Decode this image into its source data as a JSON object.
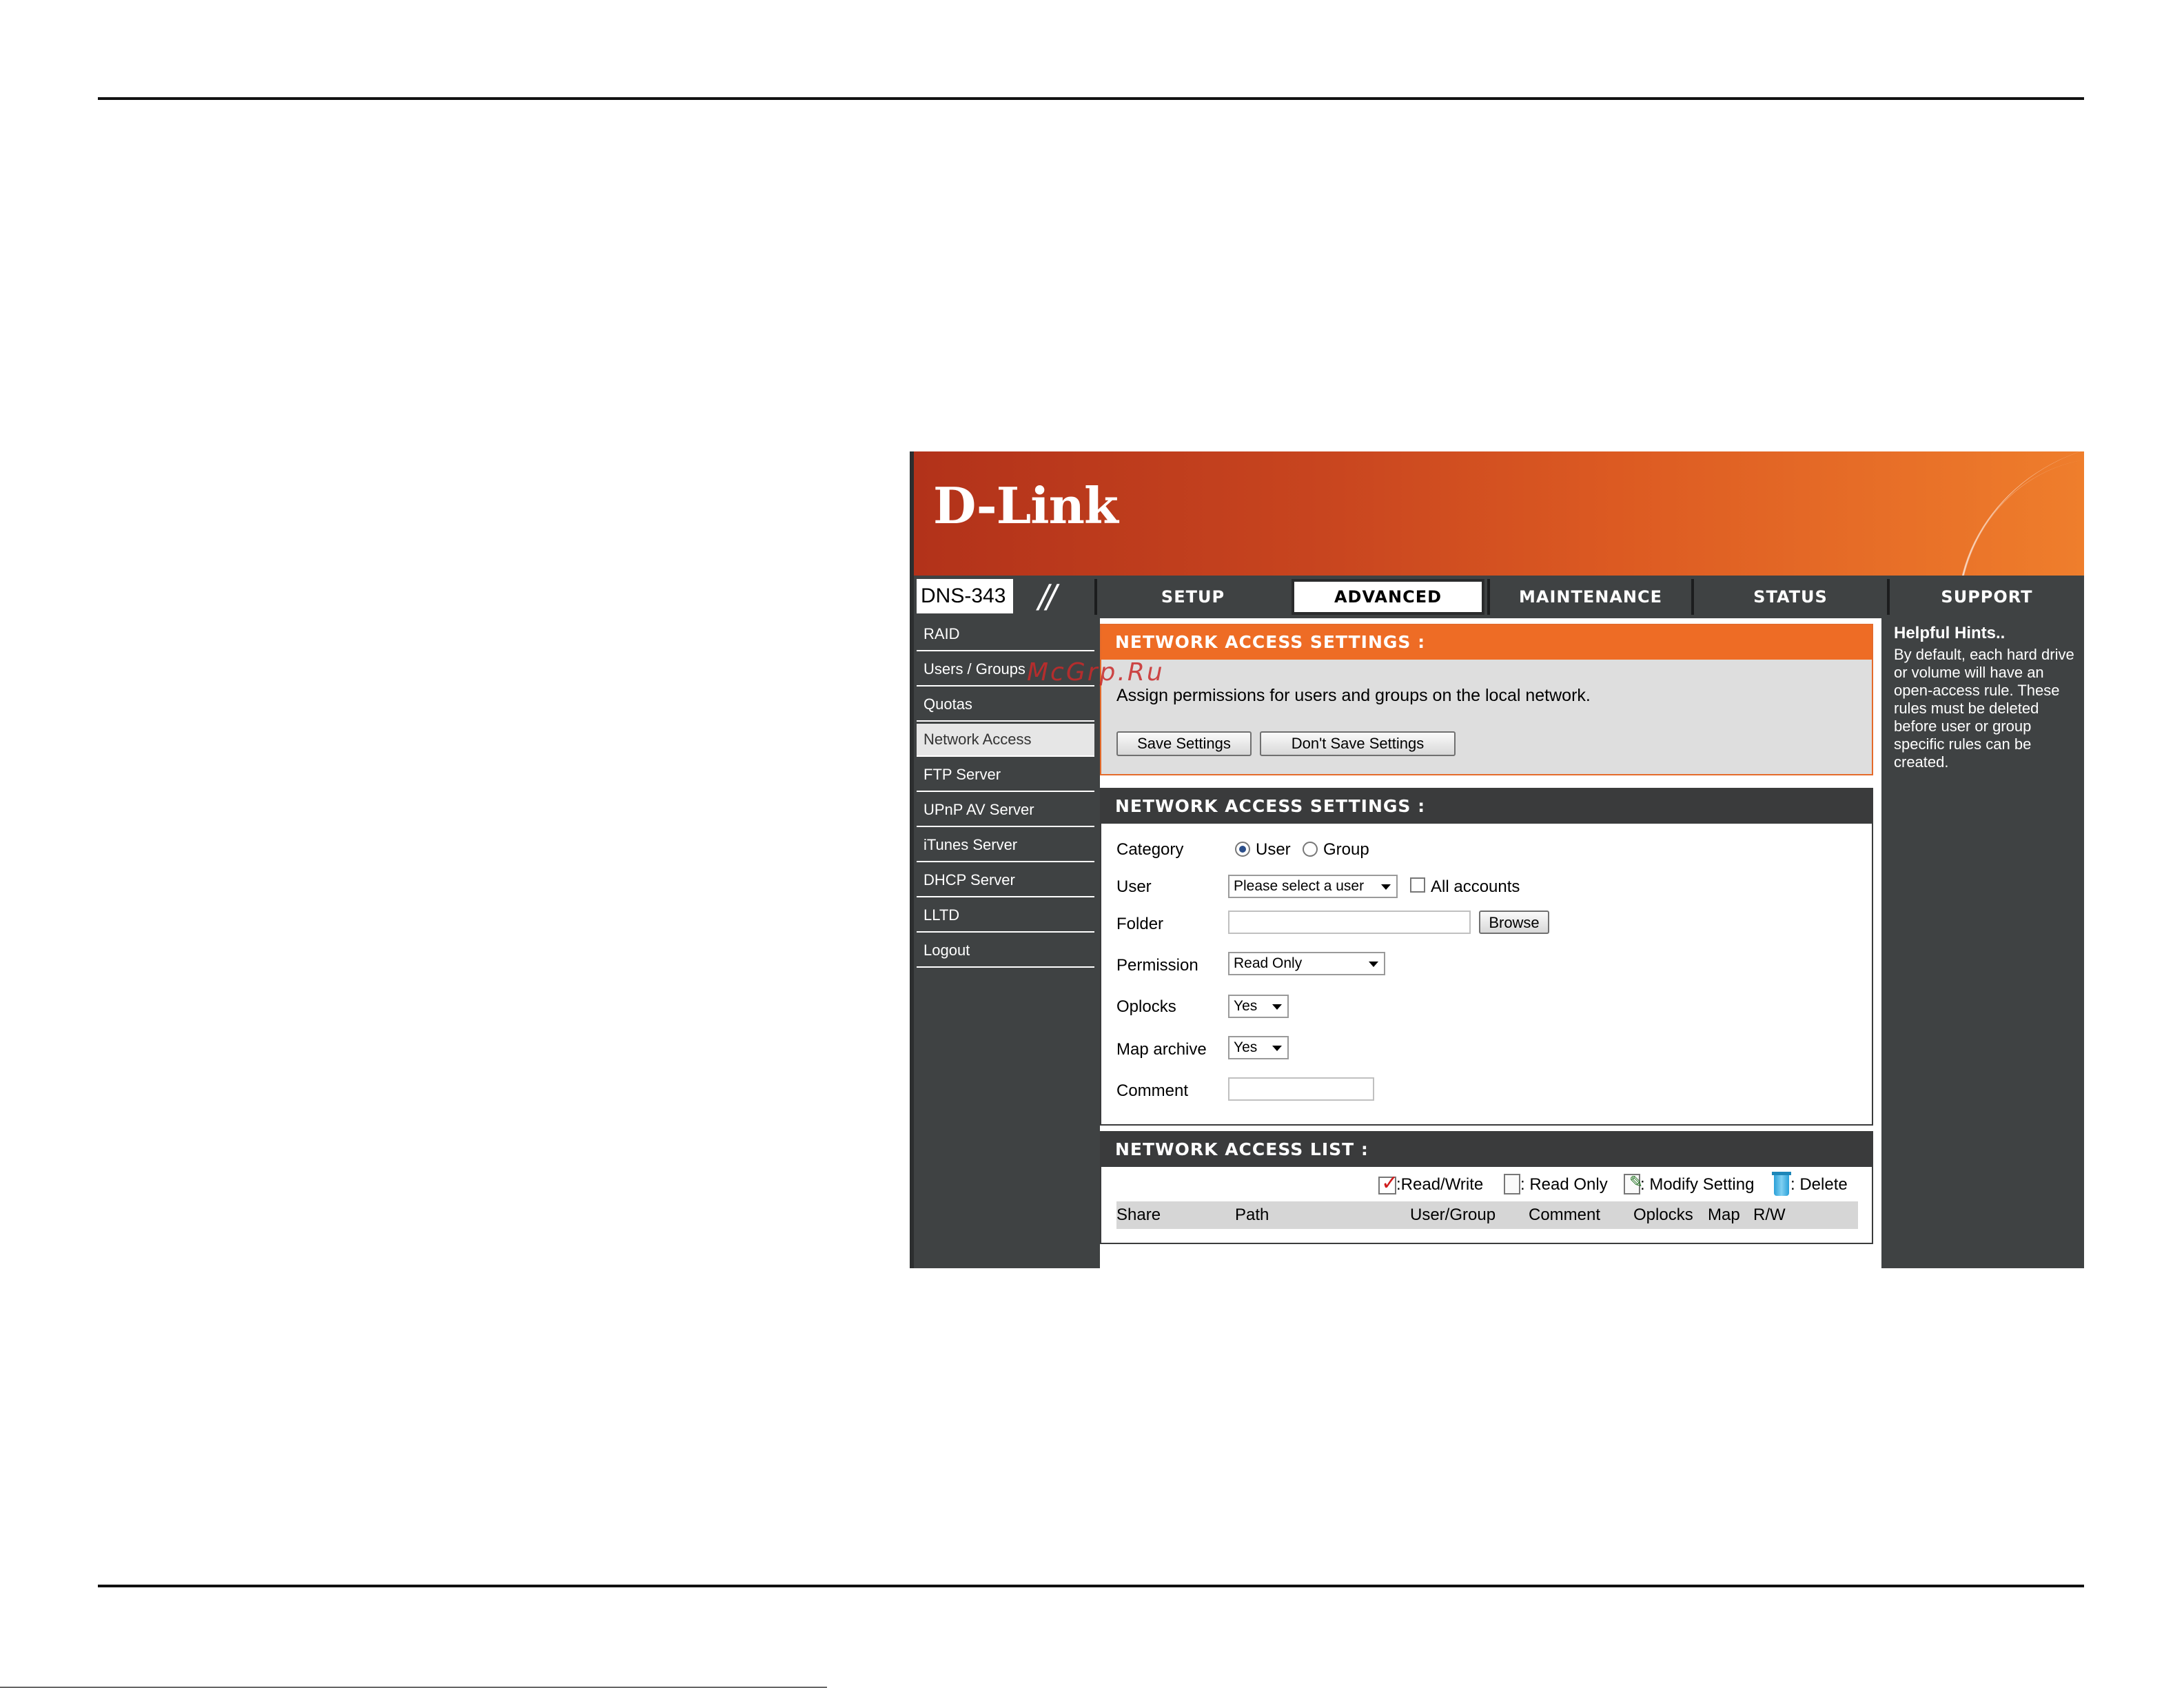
{
  "banner": {
    "logo": "D-Link"
  },
  "model": {
    "name": "DNS-343",
    "slash": "//"
  },
  "tabs": [
    {
      "label": "SETUP"
    },
    {
      "label": "ADVANCED"
    },
    {
      "label": "MAINTENANCE"
    },
    {
      "label": "STATUS"
    },
    {
      "label": "SUPPORT"
    }
  ],
  "sidebar": {
    "items": [
      {
        "label": "RAID"
      },
      {
        "label": "Users / Groups"
      },
      {
        "label": "Quotas"
      },
      {
        "label": "Network Access"
      },
      {
        "label": "FTP Server"
      },
      {
        "label": "UPnP AV Server"
      },
      {
        "label": "iTunes Server"
      },
      {
        "label": "DHCP Server"
      },
      {
        "label": "LLTD"
      },
      {
        "label": "Logout"
      }
    ]
  },
  "settings_panel": {
    "title": "NETWORK ACCESS SETTINGS :",
    "description": "Assign permissions for users and groups on the local network.",
    "save_label": "Save Settings",
    "dont_save_label": "Don't Save Settings"
  },
  "form_panel": {
    "title": "NETWORK ACCESS SETTINGS :",
    "category_label": "Category",
    "category_user": "User",
    "category_group": "Group",
    "user_label": "User",
    "user_select": "Please select a user",
    "all_accounts": "All accounts",
    "folder_label": "Folder",
    "browse_label": "Browse",
    "permission_label": "Permission",
    "permission_value": "Read Only",
    "oplocks_label": "Oplocks",
    "oplocks_value": "Yes",
    "map_archive_label": "Map archive",
    "map_archive_value": "Yes",
    "comment_label": "Comment"
  },
  "list_panel": {
    "title": "NETWORK ACCESS LIST :",
    "legend": {
      "read_write": ":Read/Write",
      "read_only": ": Read Only",
      "modify": ": Modify Setting",
      "delete": ": Delete"
    },
    "columns": [
      "Share",
      "Path",
      "User/Group",
      "Comment",
      "Oplocks",
      "Map",
      "R/W"
    ]
  },
  "hints": {
    "title": "Helpful Hints..",
    "body": "By default, each hard drive or volume will have an open-access rule. These rules must be deleted before user or group specific rules can be created."
  },
  "watermark": "McGrp.Ru"
}
